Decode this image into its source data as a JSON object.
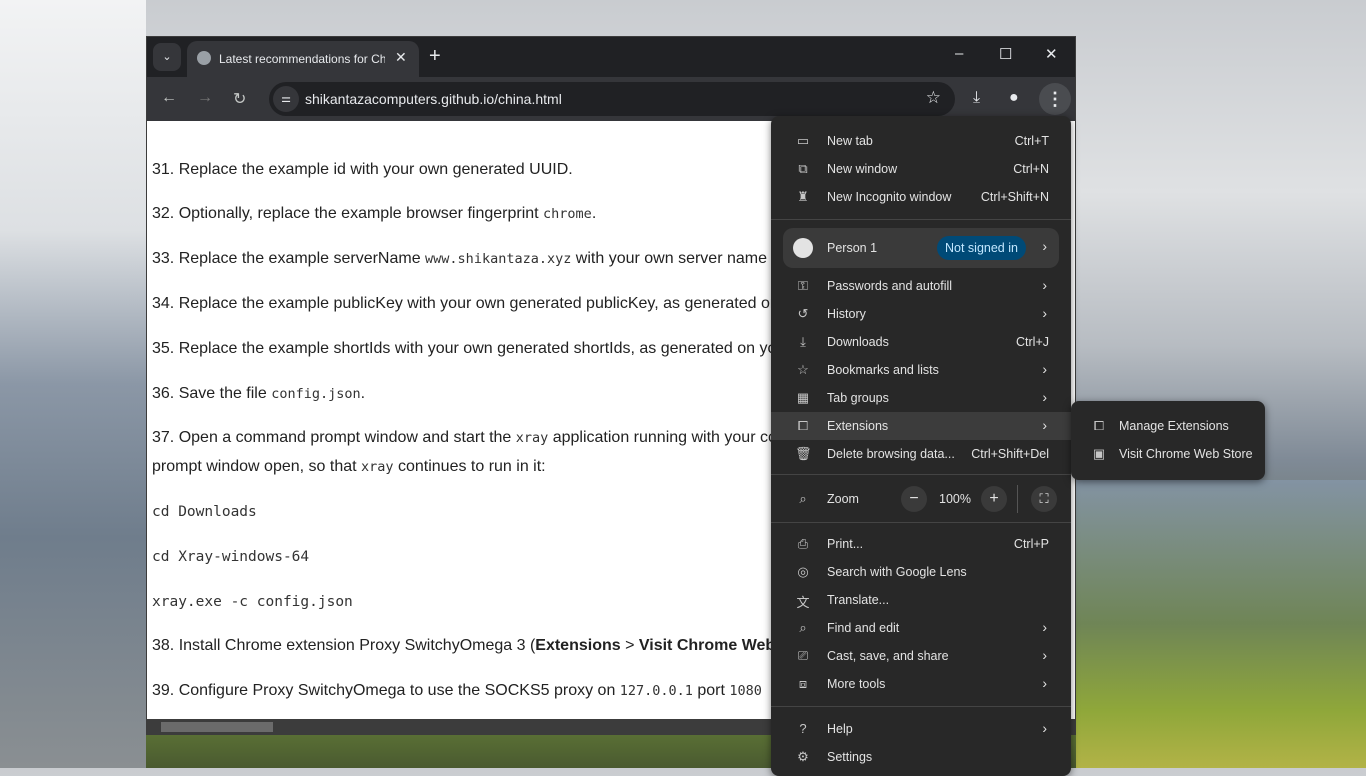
{
  "tab": {
    "title": "Latest recommendations for China",
    "icon": "globe-icon"
  },
  "window_controls": {
    "minimize": "–",
    "maximize": "☐",
    "close": "✕"
  },
  "omnibox": {
    "url": "shikantazacomputers.github.io/china.html"
  },
  "content": {
    "items": [
      {
        "num": "31.",
        "parts": [
          {
            "t": "Replace the example id with your own generated UUID."
          }
        ]
      },
      {
        "num": "32.",
        "parts": [
          {
            "t": "Optionally, replace the example browser fingerprint "
          },
          {
            "c": "chrome"
          },
          {
            "t": "."
          }
        ]
      },
      {
        "num": "33.",
        "parts": [
          {
            "t": "Replace the example serverName "
          },
          {
            "c": "www.shikantaza.xyz"
          },
          {
            "t": " with your own server name"
          }
        ]
      },
      {
        "num": "34.",
        "parts": [
          {
            "t": "Replace the example publicKey with your own generated publicKey, as generated on"
          }
        ]
      },
      {
        "num": "35.",
        "parts": [
          {
            "t": "Replace the example shortIds with your own generated shortIds, as generated on yo"
          }
        ]
      },
      {
        "num": "36.",
        "parts": [
          {
            "t": "Save the file "
          },
          {
            "c": "config.json"
          },
          {
            "t": "."
          }
        ]
      },
      {
        "num": "37.",
        "parts": [
          {
            "t": "Open a command prompt window and start the "
          },
          {
            "c": "xray"
          },
          {
            "t": " application running with your co"
          }
        ]
      }
    ],
    "line37b": [
      {
        "t": "prompt window open, so that "
      },
      {
        "c": "xray"
      },
      {
        "t": " continues to run in it:"
      }
    ],
    "code": [
      "cd Downloads",
      "cd Xray-windows-64",
      "xray.exe -c config.json"
    ],
    "item38": {
      "pre": "38. Install Chrome extension Proxy SwitchyOmega 3 (",
      "b1": "Extensions",
      "mid": " > ",
      "b2": "Visit Chrome Web"
    },
    "item39": {
      "pre": "39. Configure Proxy SwitchyOmega to use the SOCKS5 proxy on ",
      "c1": "127.0.0.1",
      "mid": " port ",
      "c2": "1080"
    }
  },
  "menu": {
    "top": [
      {
        "icon": "new-tab-icon",
        "g": "▭",
        "label": "New tab",
        "shortcut": "Ctrl+T"
      },
      {
        "icon": "new-window-icon",
        "g": "⧉",
        "label": "New window",
        "shortcut": "Ctrl+N"
      },
      {
        "icon": "incognito-icon",
        "g": "♜",
        "label": "New Incognito window",
        "shortcut": "Ctrl+Shift+N"
      }
    ],
    "person": {
      "name": "Person 1",
      "status": "Not signed in"
    },
    "mid": [
      {
        "icon": "key-icon",
        "g": "⚿",
        "label": "Passwords and autofill",
        "arrow": true
      },
      {
        "icon": "history-icon",
        "g": "↺",
        "label": "History",
        "arrow": true
      },
      {
        "icon": "download-icon",
        "g": "⤓",
        "label": "Downloads",
        "shortcut": "Ctrl+J"
      },
      {
        "icon": "star-icon",
        "g": "☆",
        "label": "Bookmarks and lists",
        "arrow": true
      },
      {
        "icon": "tab-groups-icon",
        "g": "▦",
        "label": "Tab groups",
        "arrow": true
      },
      {
        "icon": "extensions-icon",
        "g": "⧠",
        "label": "Extensions",
        "arrow": true,
        "highlight": true
      },
      {
        "icon": "trash-icon",
        "g": "🗑",
        "label": "Delete browsing data...",
        "shortcut": "Ctrl+Shift+Del"
      }
    ],
    "zoom": {
      "label": "Zoom",
      "value": "100%",
      "minus": "−",
      "plus": "+"
    },
    "tools": [
      {
        "icon": "print-icon",
        "g": "⎙",
        "label": "Print...",
        "shortcut": "Ctrl+P"
      },
      {
        "icon": "google-lens-icon",
        "g": "◎",
        "label": "Search with Google Lens"
      },
      {
        "icon": "translate-icon",
        "g": "文",
        "label": "Translate..."
      },
      {
        "icon": "find-icon",
        "g": "⌕",
        "label": "Find and edit",
        "arrow": true
      },
      {
        "icon": "cast-icon",
        "g": "⎚",
        "label": "Cast, save, and share",
        "arrow": true
      },
      {
        "icon": "toolbox-icon",
        "g": "⧈",
        "label": "More tools",
        "arrow": true
      }
    ],
    "bottom": [
      {
        "icon": "help-icon",
        "g": "?",
        "label": "Help",
        "arrow": true
      },
      {
        "icon": "settings-icon",
        "g": "⚙",
        "label": "Settings"
      }
    ]
  },
  "submenu": [
    {
      "icon": "extensions-icon",
      "g": "⧠",
      "label": "Manage Extensions"
    },
    {
      "icon": "web-store-icon",
      "g": "▣",
      "label": "Visit Chrome Web Store"
    }
  ]
}
